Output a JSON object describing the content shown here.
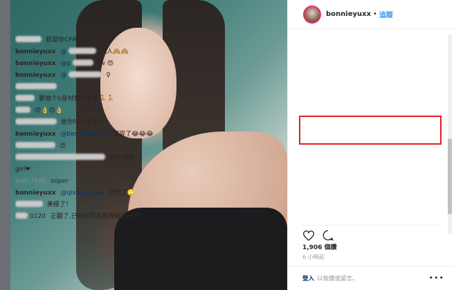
{
  "header": {
    "username": "bonnieyuxx",
    "separator": "•",
    "follow_label": "追蹤"
  },
  "comments": [
    {
      "user": "",
      "text": "我幫你CPR😍🙀"
    },
    {
      "user": "bonnieyuxx",
      "mention": "@",
      "text": "威人🙈🙈"
    },
    {
      "user": "bonnieyuxx",
      "mention": "@p",
      "text": "tw 😍"
    },
    {
      "user": "bonnieyuxx",
      "mention": "@",
      "text": "♀"
    },
    {
      "user": "",
      "text": ""
    },
    {
      "user": "",
      "text": "要做个S身材魅力女主🏃🏃"
    },
    {
      "user": "",
      "text": "😍👌😍👌"
    },
    {
      "user": "",
      "text": "是你吗？不像了"
    },
    {
      "user": "bonnieyuxx",
      "mention": "@bensonli9999",
      "text": "整容了😂😂😂"
    },
    {
      "user": "",
      "text": "😍"
    },
    {
      "user": "",
      "text": "很实诚的"
    },
    {
      "user": "",
      "text": "girl❤"
    },
    {
      "user": "kodi:7100",
      "text": "súper"
    },
    {
      "user": "bonnieyuxx",
      "mention": "@qixiangzhao",
      "text": "怎麼了🙄"
    },
    {
      "user": "",
      "text": "美極了！"
    },
    {
      "user": "0120",
      "text": "正翻了,已經是寫真集等級的美照!"
    }
  ],
  "likes_text": "1,906 個讚",
  "time_text": "6 小時前",
  "footer": {
    "login_label": "登入",
    "footer_text": "以按讚或留言。"
  },
  "more_label": "•••",
  "colors": {
    "highlight": "#e31b23",
    "link": "#3897f0"
  }
}
